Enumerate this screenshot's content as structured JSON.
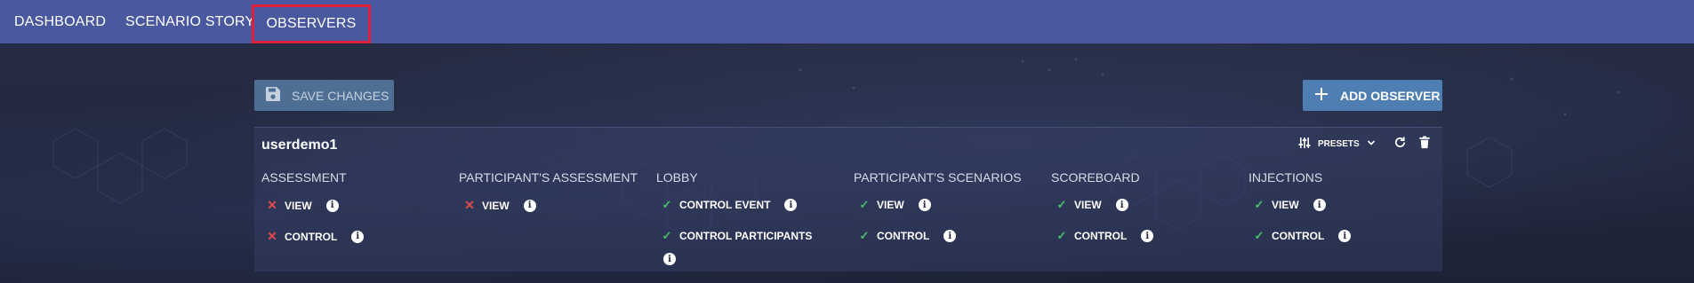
{
  "nav": {
    "tabs": [
      {
        "label": "DASHBOARD"
      },
      {
        "label": "SCENARIO STORY"
      },
      {
        "label": "OBSERVERS"
      }
    ]
  },
  "toolbar": {
    "save_label": "SAVE CHANGES",
    "add_label": "ADD OBSERVER"
  },
  "observer": {
    "name": "userdemo1",
    "presets_label": "PRESETS",
    "columns": [
      {
        "title": "ASSESSMENT",
        "perms": [
          {
            "label": "VIEW",
            "state": "denied"
          },
          {
            "label": "CONTROL",
            "state": "denied"
          }
        ]
      },
      {
        "title": "PARTICIPANT'S ASSESSMENT",
        "perms": [
          {
            "label": "VIEW",
            "state": "denied"
          }
        ]
      },
      {
        "title": "LOBBY",
        "perms": [
          {
            "label": "CONTROL EVENT",
            "state": "granted"
          },
          {
            "label": "CONTROL PARTICIPANTS",
            "state": "granted"
          }
        ]
      },
      {
        "title": "PARTICIPANT'S SCENARIOS",
        "perms": [
          {
            "label": "VIEW",
            "state": "granted"
          },
          {
            "label": "CONTROL",
            "state": "granted"
          }
        ]
      },
      {
        "title": "SCOREBOARD",
        "perms": [
          {
            "label": "VIEW",
            "state": "granted"
          },
          {
            "label": "CONTROL",
            "state": "granted"
          }
        ]
      },
      {
        "title": "INJECTIONS",
        "perms": [
          {
            "label": "VIEW",
            "state": "granted"
          },
          {
            "label": "CONTROL",
            "state": "granted"
          }
        ]
      }
    ]
  },
  "icons": {
    "save": "floppy-disk-icon",
    "add": "plus-icon",
    "presets": "sliders-icon",
    "refresh": "refresh-icon",
    "delete": "trash-icon",
    "granted": "check-icon",
    "denied": "close-icon",
    "info": "info-icon"
  },
  "colors": {
    "topbar": "#4a58a0",
    "active_tab_outline": "#e0203a",
    "granted": "#4cbf6a",
    "denied": "#e04b4b"
  }
}
